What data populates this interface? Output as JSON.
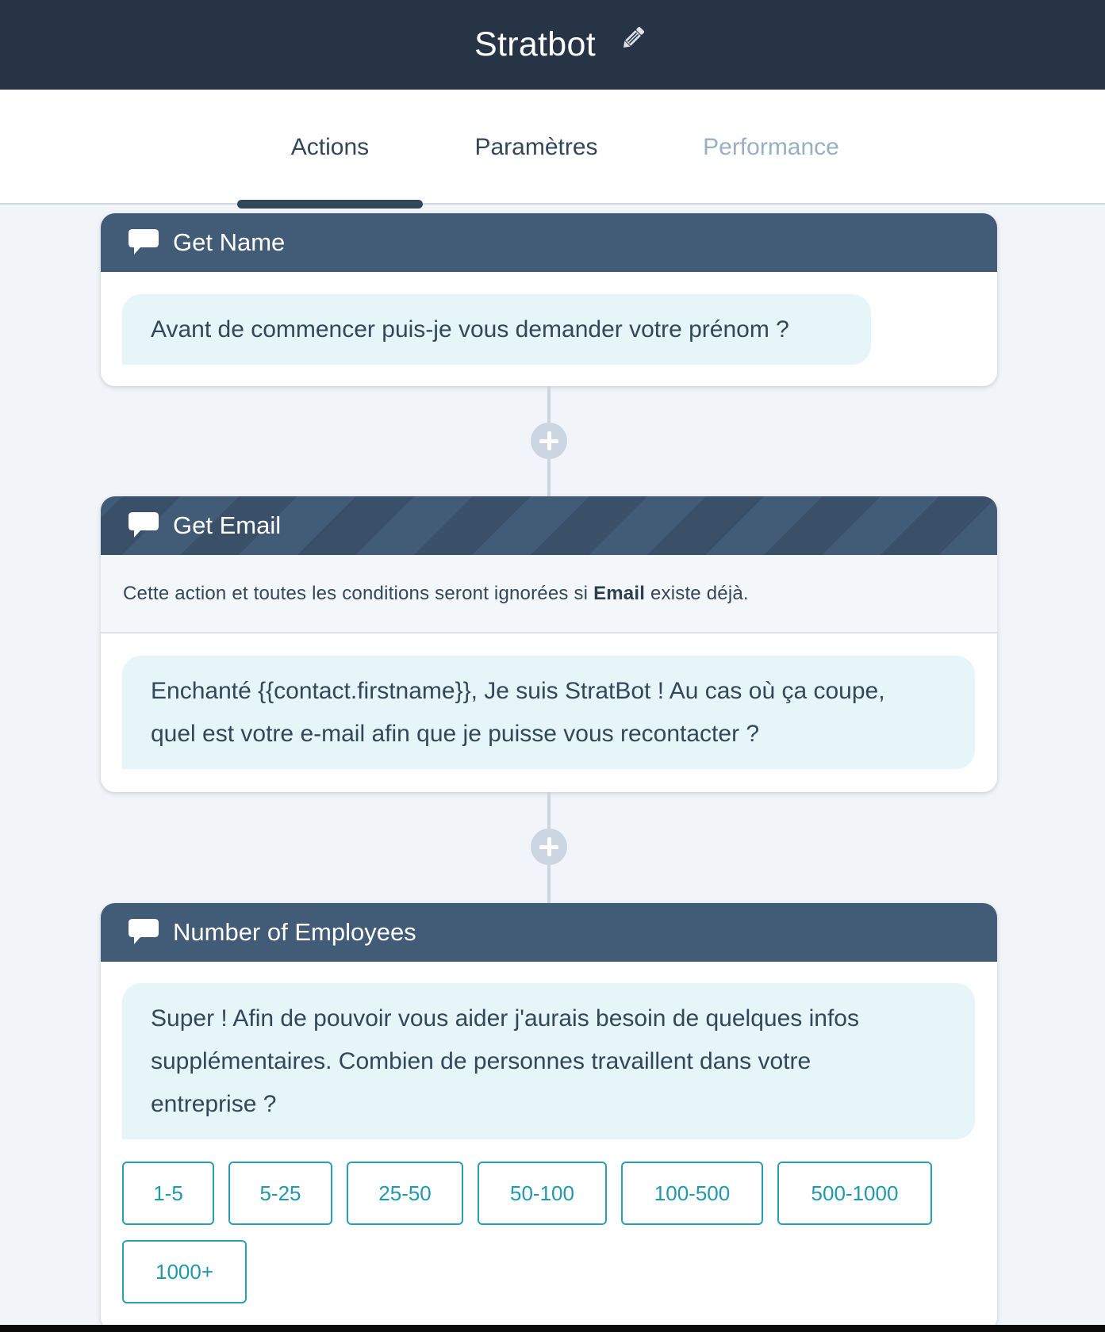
{
  "header": {
    "title": "Stratbot",
    "edit_icon": "pencil-icon"
  },
  "tabs": [
    {
      "label": "Actions",
      "active": true
    },
    {
      "label": "Paramètres",
      "active": false
    },
    {
      "label": "Performance",
      "active": false,
      "disabled": true
    }
  ],
  "actions": [
    {
      "title": "Get Name",
      "icon": "chat-bubble-icon",
      "message": "Avant de commencer puis-je vous demander votre prénom ?"
    },
    {
      "title": "Get Email",
      "icon": "chat-bubble-icon",
      "notice": {
        "before": "Cette action et toutes les conditions seront ignorées si ",
        "field": "Email",
        "after": " existe déjà."
      },
      "message_line1": "Enchanté {{contact.firstname}}, Je suis StratBot ! Au cas où ça coupe,",
      "message_line2": "quel est votre e-mail afin que je puisse vous recontacter ?"
    },
    {
      "title": "Number of Employees",
      "icon": "chat-bubble-icon",
      "message_line1": "Super ! Afin de pouvoir vous aider j'aurais besoin de quelques infos",
      "message_line2": "supplémentaires. Combien de personnes travaillent dans votre",
      "message_line3": "entreprise ?",
      "options": [
        "1-5",
        "5-25",
        "25-50",
        "50-100",
        "100-500",
        "500-1000",
        "1000+"
      ]
    }
  ],
  "colors": {
    "topbar": "#273445",
    "card_header": "#425b76",
    "bubble": "#e5f5f8",
    "option_accent": "#2a9fb3",
    "text": "#33475b"
  }
}
